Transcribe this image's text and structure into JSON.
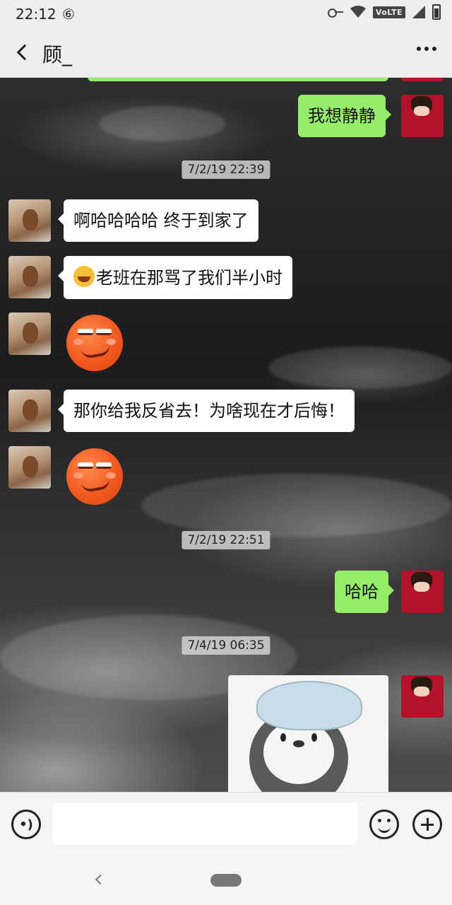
{
  "status_bar": {
    "time": "22:12",
    "sync_glyph": "⑥",
    "volte": "VoLTE"
  },
  "header": {
    "title": "顾_"
  },
  "messages": {
    "top_text": "我想静静",
    "ts1": "7/2/19 22:39",
    "m1": "啊哈哈哈哈 终于到家了",
    "m2": "老班在那骂了我们半小时",
    "m3": "那你给我反省去！为啥现在才后悔！",
    "ts2": "7/2/19 22:51",
    "m4": "哈哈",
    "ts3": "7/4/19 06:35"
  },
  "input": {
    "value": "",
    "placeholder": ""
  },
  "colors": {
    "sent_bubble": "#95ec69",
    "received_bubble": "#ffffff",
    "header_bg": "#ededed"
  },
  "icons": {
    "back": "chevron-left-icon",
    "more": "more-dots-icon",
    "voice": "voice-icon",
    "emoji": "emoji-icon",
    "plus": "plus-icon"
  }
}
